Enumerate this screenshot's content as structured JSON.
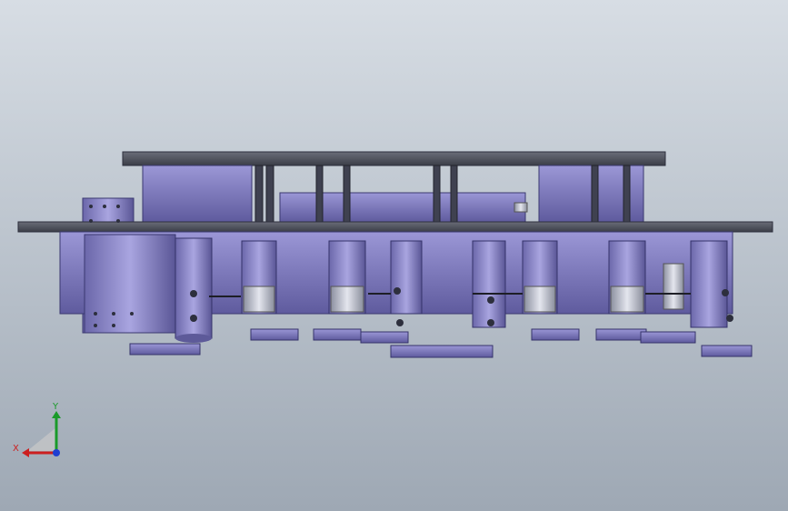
{
  "scene": {
    "description_free": true,
    "colors": {
      "bg_top": "#d7dde4",
      "bg_bottom": "#9ea8b4",
      "plate_dark": "#4a4e58",
      "frame_purple": "#7a76b8",
      "frame_purple_light": "#a6a2dc",
      "frame_purple_dark": "#4c4882",
      "steel": "#c9ccd4",
      "shadow": "#2d2f3d"
    }
  },
  "triad": {
    "x_label": "X",
    "y_label": "Y",
    "x_color": "#cc1f1f",
    "y_color": "#1a9a2a",
    "z_color": "#1f3fd1",
    "icon": "coordinate-triad-icon"
  }
}
